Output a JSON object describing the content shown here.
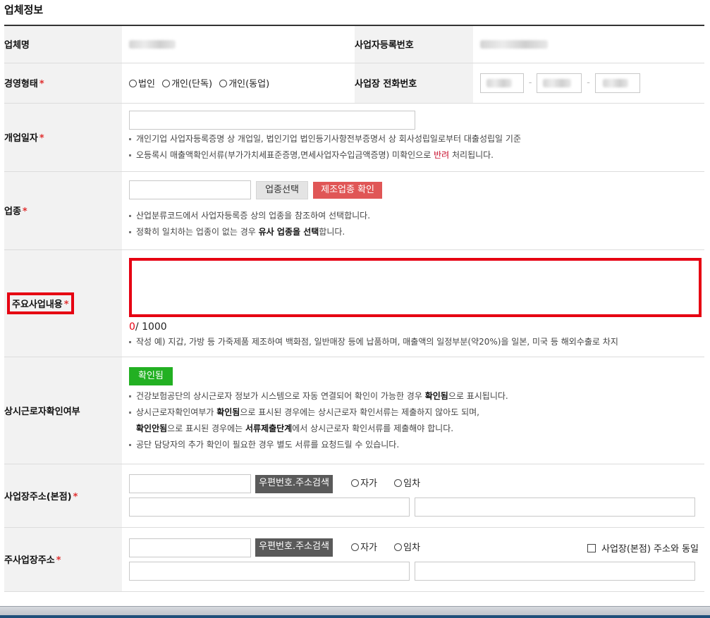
{
  "section_title": "업체정보",
  "rows": {
    "company_name": {
      "label": "업체명"
    },
    "business_reg_no": {
      "label": "사업자등록번호"
    },
    "management_type": {
      "label": "경영형태",
      "options": [
        "법인",
        "개인(단독)",
        "개인(동업)"
      ]
    },
    "business_phone": {
      "label": "사업장 전화번호"
    },
    "open_date": {
      "label": "개업일자",
      "notes": [
        "개인기업 사업자등록증명 상 개업일, 법인기업 법인등기사항전부증명서 상 회사성립일로부터 대출성립일 기준",
        "오등록시 매출액확인서류(부가가치세표준증명,면세사업자수입금액증명) 미확인으로 "
      ],
      "note2_red": "반려",
      "note2_tail": " 처리됩니다."
    },
    "industry": {
      "label": "업종",
      "select_button": "업종선택",
      "confirm_button": "제조업종 확인",
      "note1": "산업분류코드에서 사업자등록증 상의 업종을 참조하여 선택합니다.",
      "note2_pre": "정확히 일치하는 업종이 없는 경우 ",
      "note2_bold": "유사 업종을 선택",
      "note2_post": "합니다."
    },
    "main_business": {
      "label": "주요사업내용",
      "counter_current": "0",
      "counter_max": "/ 1000",
      "note": "작성 예) 지갑, 가방 등 가죽제품 제조하여 백화점, 일반매장 등에 납품하며, 매출액의 일정부분(약20%)을 일본, 미국 등 해외수출로 차지"
    },
    "fulltime_workers": {
      "label": "상시근로자확인여부",
      "status_button": "확인됨",
      "note1_pre": "건강보험공단의 상시근로자 정보가 시스템으로 자동 연결되어 확인이 가능한 경우 ",
      "note1_bold": "확인됨",
      "note1_post": "으로 표시됩니다.",
      "note2_pre": "상시근로자확인여부가 ",
      "note2_bold": "확인됨",
      "note2_post": "으로 표시된 경우에는 상시근로자 확인서류는 제출하지 않아도 되며,",
      "note3_bold1": "확인안됨",
      "note3_mid": "으로 표시된 경우에는 ",
      "note3_bold2": "서류제출단계",
      "note3_post": "에서 상시근로자 확인서류를 제출해야 합니다.",
      "note4": "공단 담당자의 추가 확인이 필요한 경우 별도 서류를 요청드릴 수 있습니다."
    },
    "hq_address": {
      "label": "사업장주소(본점)",
      "search_button": "우편번호.주소검색",
      "options": [
        "자가",
        "임차"
      ]
    },
    "main_address": {
      "label": "주사업장주소",
      "search_button": "우편번호.주소검색",
      "options": [
        "자가",
        "임차"
      ],
      "same_as_label": "사업장(본점) 주소와 동일"
    }
  },
  "colors": {
    "required_mark": "#e03030",
    "highlight_border": "#e60012",
    "confirm_button_bg": "#e05656",
    "verified_button_bg": "#22b022",
    "search_button_bg": "#5a5a5a"
  }
}
